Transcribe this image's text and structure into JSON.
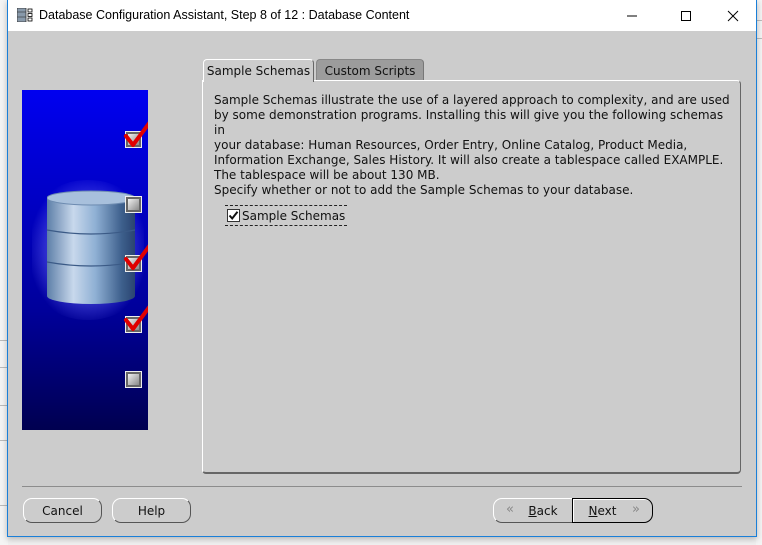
{
  "window": {
    "title": "Database Configuration Assistant, Step 8 of 12 : Database Content",
    "controls": [
      "minimize",
      "maximize",
      "close"
    ]
  },
  "side_panel": {
    "steps": [
      {
        "state": "checked"
      },
      {
        "state": "unchecked"
      },
      {
        "state": "checked"
      },
      {
        "state": "checked"
      },
      {
        "state": "unchecked"
      }
    ]
  },
  "tabs": [
    {
      "label": "Sample Schemas",
      "active": true
    },
    {
      "label": "Custom Scripts",
      "active": false
    }
  ],
  "content": {
    "description_lines": [
      "Sample Schemas illustrate the use of a layered approach to complexity, and are used",
      "by some demonstration programs. Installing this will give you the following schemas in",
      "your database: Human Resources, Order Entry, Online Catalog, Product Media,",
      "Information Exchange, Sales History. It will also create a tablespace called EXAMPLE.",
      "The tablespace will be about 130 MB."
    ],
    "prompt": "Specify whether or not to add the Sample Schemas to your database.",
    "checkbox": {
      "label": "Sample Schemas",
      "checked": true
    }
  },
  "buttons": {
    "cancel": "Cancel",
    "help": "Help",
    "back_mnemonic": "B",
    "back_rest": "ack",
    "next_mnemonic": "N",
    "next_rest": "ext"
  },
  "colors": {
    "window_border": "#1a7fd8",
    "dialog_bg": "#cccccc",
    "check_red": "#e00000"
  }
}
